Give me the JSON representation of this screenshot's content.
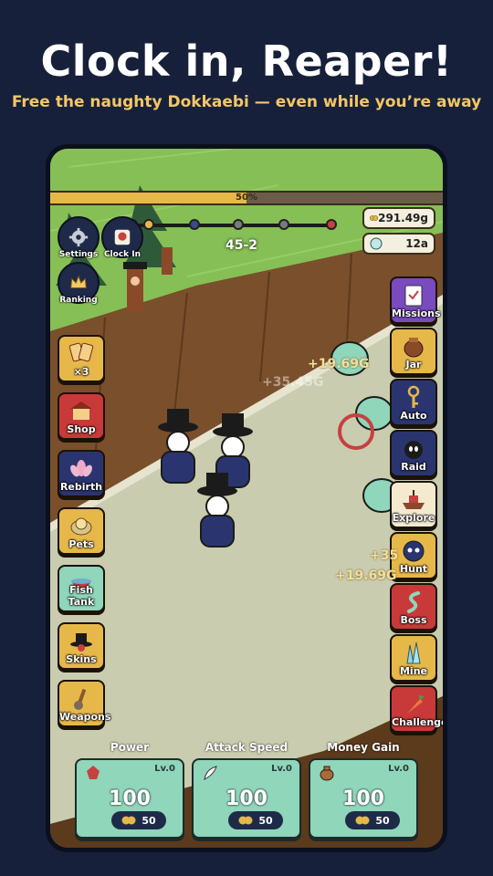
{
  "promo": {
    "headline": "Clock in, Reaper!",
    "subline": "Free the naughty Dokkaebi — even while you’re away"
  },
  "hud": {
    "progress_value": 0.5,
    "progress_text": "50%",
    "stage": "45-2",
    "gold": "291.49g",
    "gems": "12a",
    "top_buttons": [
      {
        "label": "Settings",
        "icon": "gear-icon"
      },
      {
        "label": "Clock In",
        "icon": "clock-in-icon"
      },
      {
        "label": "Ranking",
        "icon": "crown-icon"
      }
    ]
  },
  "left_menu": [
    {
      "label": "×3",
      "icon": "cards-icon"
    },
    {
      "label": "Shop",
      "icon": "shop-icon"
    },
    {
      "label": "Rebirth",
      "icon": "lotus-icon"
    },
    {
      "label": "Pets",
      "icon": "pet-icon"
    },
    {
      "label": "Fish Tank",
      "icon": "fish-bowl-icon"
    },
    {
      "label": "Skins",
      "icon": "hat-icon"
    },
    {
      "label": "Weapons",
      "icon": "weapon-icon"
    }
  ],
  "right_menu": [
    {
      "label": "Missions",
      "icon": "clipboard-icon"
    },
    {
      "label": "Jar",
      "icon": "jar-icon"
    },
    {
      "label": "Auto",
      "icon": "key-icon"
    },
    {
      "label": "Raid",
      "icon": "bomb-icon"
    },
    {
      "label": "Explore",
      "icon": "boat-icon"
    },
    {
      "label": "Hunt",
      "icon": "ghost-icon"
    },
    {
      "label": "Boss",
      "icon": "snake-icon"
    },
    {
      "label": "Mine",
      "icon": "crystal-icon"
    },
    {
      "label": "Challenge",
      "icon": "carrot-icon"
    }
  ],
  "floating_texts": [
    "+19.69G",
    "+35.45G",
    "+19.69G",
    "+35"
  ],
  "upgrades": [
    {
      "title": "Power",
      "level": "Lv.0",
      "value": "100",
      "cost": "50",
      "icon": "leaf-icon"
    },
    {
      "title": "Attack Speed",
      "level": "Lv.0",
      "value": "100",
      "cost": "50",
      "icon": "feather-icon"
    },
    {
      "title": "Money Gain",
      "level": "Lv.0",
      "value": "100",
      "cost": "50",
      "icon": "money-bag-icon"
    }
  ],
  "colors": {
    "background": "#16203a",
    "subline": "#f3c766",
    "upgrade_card": "#8fd6bb",
    "progress_fill": "#e6b84a"
  }
}
